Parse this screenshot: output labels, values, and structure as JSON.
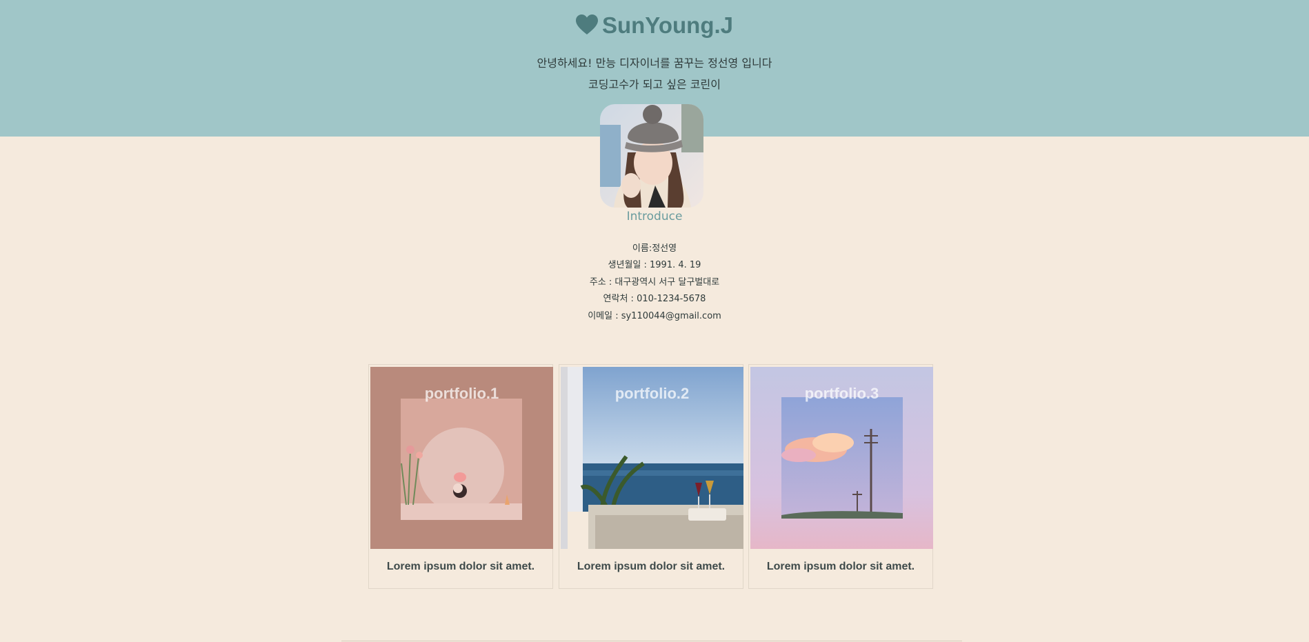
{
  "header": {
    "title": "SunYoung.J",
    "title_icon": "heart-icon",
    "greeting_line1": "안녕하세요! 만능 디자이너를 꿈꾸는 정선영 입니다",
    "greeting_line2": "코딩고수가 되고 싶은 코린이",
    "bg_color": "#a0c6c8",
    "accent_color": "#4e7c7e"
  },
  "intro": {
    "title": "Introduce",
    "name": "이름:정선영",
    "birth": "생년월일 : 1991. 4. 19",
    "address": "주소 : 대구광역시 서구 달구벌대로",
    "phone": "연락처 : 010-1234-5678",
    "email": "이메일 : sy110044@gmail.com"
  },
  "portfolio": [
    {
      "title": "portfolio.1",
      "caption": "Lorem ipsum dolor sit amet."
    },
    {
      "title": "portfolio.2",
      "caption": "Lorem ipsum dolor sit amet."
    },
    {
      "title": "portfolio.3",
      "caption": "Lorem ipsum dolor sit amet."
    }
  ]
}
